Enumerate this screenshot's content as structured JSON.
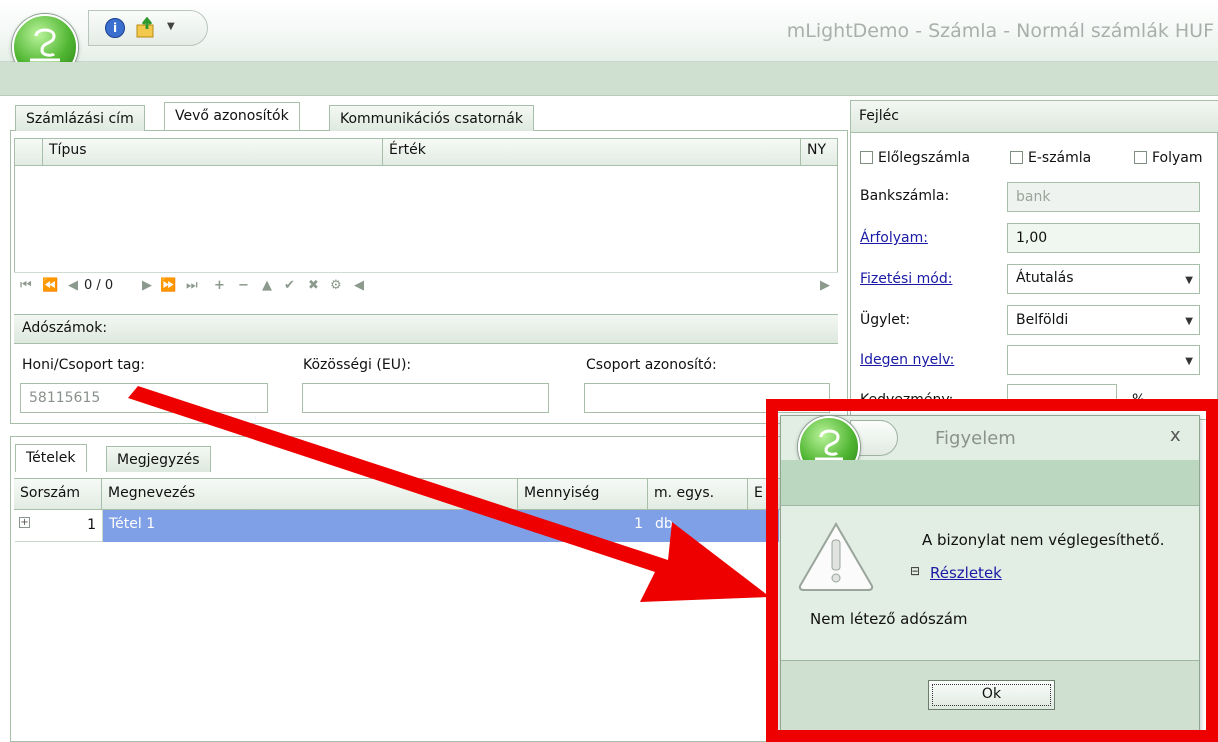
{
  "window": {
    "title": "mLightDemo - Számla - Normál számlák HUF"
  },
  "customer_tabs": [
    "Számlázási cím",
    "Vevő azonosítók",
    "Kommunikációs csatornák"
  ],
  "identifiers_grid": {
    "columns": [
      "Típus",
      "Érték",
      "NY"
    ]
  },
  "navigator": {
    "position": "0 / 0"
  },
  "tax_numbers": {
    "title": "Adószámok:",
    "domestic_label": "Honi/Csoport tag:",
    "domestic_value": "58115615",
    "eu_label": "Közösségi (EU):",
    "group_label": "Csoport azonosító:"
  },
  "item_tabs": [
    "Tételek",
    "Megjegyzés"
  ],
  "items_grid": {
    "columns": [
      "Sorszám",
      "Megnevezés",
      "Mennyiség",
      "m. egys.",
      "E"
    ],
    "rows": [
      {
        "index": "1",
        "name": "Tétel 1",
        "quantity": "1",
        "unit": "db"
      }
    ]
  },
  "header_panel": {
    "title": "Fejléc",
    "checkboxes": [
      "Előlegszámla",
      "E-számla",
      "Folyam"
    ],
    "bank_label": "Bankszámla:",
    "bank_value": "bank",
    "rate_label": "Árfolyam:",
    "rate_value": "1,00",
    "payment_label": "Fizetési mód:",
    "payment_value": "Átutalás",
    "deal_label": "Ügylet:",
    "deal_value": "Belföldi",
    "language_label": "Idegen nyelv:",
    "language_value": "",
    "discount_label": "Kedvezmény:",
    "discount_unit": "%"
  },
  "dialog": {
    "title": "Figyelem",
    "close": "x",
    "message": "A bizonylat nem véglegesíthető.",
    "details_toggle": "⊟",
    "details_link": "Részletek",
    "detail_text": "Nem létező adószám",
    "ok_label": "Ok"
  },
  "colors": {
    "annotation_red": "#ee0000",
    "selected_row": "#7f9fe6",
    "panel_border": "#a7bfa9"
  }
}
